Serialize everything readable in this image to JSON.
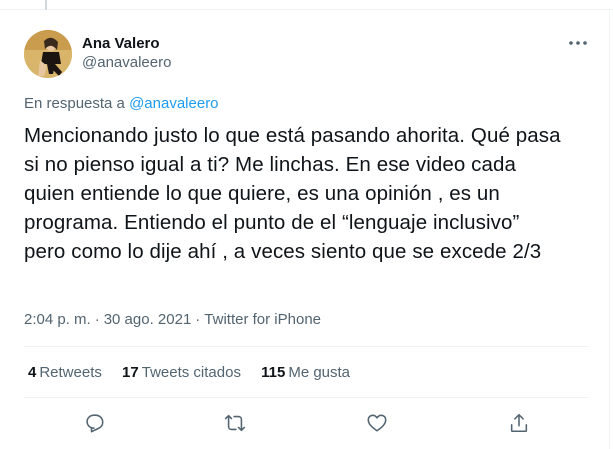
{
  "author": {
    "display_name": "Ana Valero",
    "handle": "@anavaleero"
  },
  "reply": {
    "prefix": "En respuesta a",
    "mention": "@anavaleero"
  },
  "tweet": {
    "text": "Mencionando justo lo que está pasando ahorita. Qué pasa si no pienso igual a ti? Me linchas. En ese video cada quien entiende lo que quiere, es una opinión , es un programa. Entiendo el punto de el “lenguaje inclusivo” pero como lo dije ahí , a veces siento que se excede 2/3"
  },
  "meta": {
    "time": "2:04 p. m.",
    "separator": "·",
    "date": "30 ago. 2021",
    "source": "Twitter for iPhone"
  },
  "stats": {
    "retweets_count": "4",
    "retweets_label": "Retweets",
    "quotes_count": "17",
    "quotes_label": "Tweets citados",
    "likes_count": "115",
    "likes_label": "Me gusta"
  },
  "colors": {
    "link": "#1d9bf0",
    "secondary_text": "#536471",
    "divider": "#eff3f4"
  },
  "icons": [
    "more-icon",
    "reply-icon",
    "retweet-icon",
    "like-icon",
    "share-icon"
  ]
}
